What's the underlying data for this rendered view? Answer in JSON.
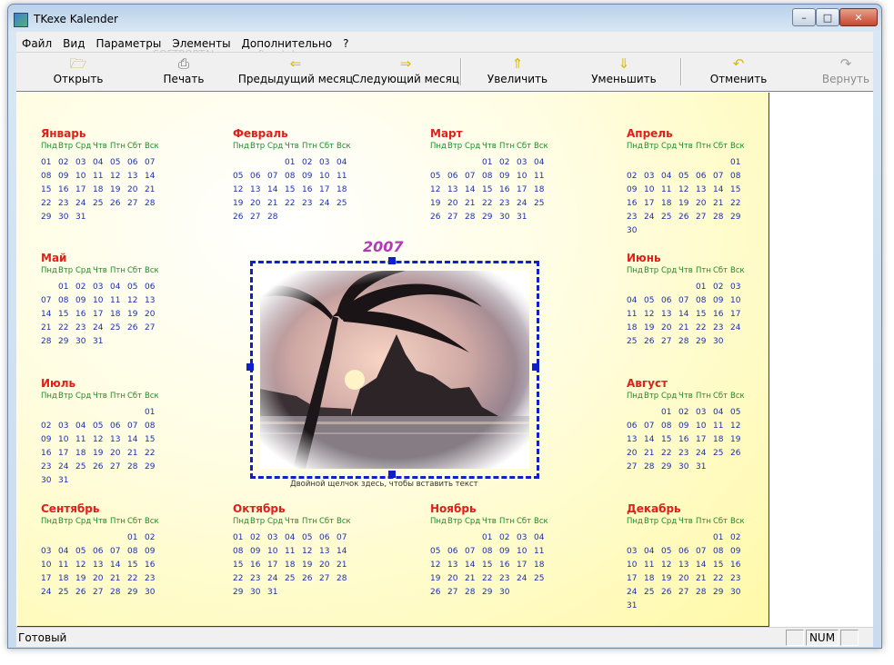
{
  "window": {
    "title": "TKexe Kalender"
  },
  "menu": [
    "Файл",
    "Вид",
    "Параметры",
    "Элементы",
    "Дополнительно",
    "?"
  ],
  "toolbar": {
    "open": "Открыть",
    "print": "Печать",
    "prev_month": "Предыдущий месяц",
    "next_month": "Следующий месяц",
    "zoom_in": "Увеличить",
    "zoom_out": "Уменьшить",
    "undo": "Отменить",
    "redo": "Вернуть"
  },
  "watermark": "SOFTPORTAL www.softportal.com",
  "calendar": {
    "year": "2007",
    "weekdays": [
      "Пнд",
      "Втр",
      "Срд",
      "Чтв",
      "Птн",
      "Сбт",
      "Вск"
    ],
    "photo_hint": "Двойной щелчок здесь, чтобы вставить текст",
    "months": [
      {
        "name": "Январь",
        "rows": [
          [
            "01",
            "02",
            "03",
            "04",
            "05",
            "06",
            "07"
          ],
          [
            "08",
            "09",
            "10",
            "11",
            "12",
            "13",
            "14"
          ],
          [
            "15",
            "16",
            "17",
            "18",
            "19",
            "20",
            "21"
          ],
          [
            "22",
            "23",
            "24",
            "25",
            "26",
            "27",
            "28"
          ],
          [
            "29",
            "30",
            "31",
            "",
            "",
            "",
            ""
          ]
        ]
      },
      {
        "name": "Февраль",
        "rows": [
          [
            "",
            "",
            "",
            "01",
            "02",
            "03",
            "04"
          ],
          [
            "05",
            "06",
            "07",
            "08",
            "09",
            "10",
            "11"
          ],
          [
            "12",
            "13",
            "14",
            "15",
            "16",
            "17",
            "18"
          ],
          [
            "19",
            "20",
            "21",
            "22",
            "23",
            "24",
            "25"
          ],
          [
            "26",
            "27",
            "28",
            "",
            "",
            "",
            ""
          ]
        ]
      },
      {
        "name": "Март",
        "rows": [
          [
            "",
            "",
            "",
            "01",
            "02",
            "03",
            "04"
          ],
          [
            "05",
            "06",
            "07",
            "08",
            "09",
            "10",
            "11"
          ],
          [
            "12",
            "13",
            "14",
            "15",
            "16",
            "17",
            "18"
          ],
          [
            "19",
            "20",
            "21",
            "22",
            "23",
            "24",
            "25"
          ],
          [
            "26",
            "27",
            "28",
            "29",
            "30",
            "31",
            ""
          ]
        ]
      },
      {
        "name": "Апрель",
        "rows": [
          [
            "",
            "",
            "",
            "",
            "",
            "",
            "01"
          ],
          [
            "02",
            "03",
            "04",
            "05",
            "06",
            "07",
            "08"
          ],
          [
            "09",
            "10",
            "11",
            "12",
            "13",
            "14",
            "15"
          ],
          [
            "16",
            "17",
            "18",
            "19",
            "20",
            "21",
            "22"
          ],
          [
            "23",
            "24",
            "25",
            "26",
            "27",
            "28",
            "29"
          ],
          [
            "30",
            "",
            "",
            "",
            "",
            "",
            ""
          ]
        ]
      },
      {
        "name": "Май",
        "rows": [
          [
            "",
            "01",
            "02",
            "03",
            "04",
            "05",
            "06"
          ],
          [
            "07",
            "08",
            "09",
            "10",
            "11",
            "12",
            "13"
          ],
          [
            "14",
            "15",
            "16",
            "17",
            "18",
            "19",
            "20"
          ],
          [
            "21",
            "22",
            "23",
            "24",
            "25",
            "26",
            "27"
          ],
          [
            "28",
            "29",
            "30",
            "31",
            "",
            "",
            ""
          ]
        ]
      },
      {
        "name": "Июнь",
        "rows": [
          [
            "",
            "",
            "",
            "",
            "01",
            "02",
            "03"
          ],
          [
            "04",
            "05",
            "06",
            "07",
            "08",
            "09",
            "10"
          ],
          [
            "11",
            "12",
            "13",
            "14",
            "15",
            "16",
            "17"
          ],
          [
            "18",
            "19",
            "20",
            "21",
            "22",
            "23",
            "24"
          ],
          [
            "25",
            "26",
            "27",
            "28",
            "29",
            "30",
            ""
          ]
        ]
      },
      {
        "name": "Июль",
        "rows": [
          [
            "",
            "",
            "",
            "",
            "",
            "",
            "01"
          ],
          [
            "02",
            "03",
            "04",
            "05",
            "06",
            "07",
            "08"
          ],
          [
            "09",
            "10",
            "11",
            "12",
            "13",
            "14",
            "15"
          ],
          [
            "16",
            "17",
            "18",
            "19",
            "20",
            "21",
            "22"
          ],
          [
            "23",
            "24",
            "25",
            "26",
            "27",
            "28",
            "29"
          ],
          [
            "30",
            "31",
            "",
            "",
            "",
            "",
            ""
          ]
        ]
      },
      {
        "name": "Август",
        "rows": [
          [
            "",
            "",
            "01",
            "02",
            "03",
            "04",
            "05"
          ],
          [
            "06",
            "07",
            "08",
            "09",
            "10",
            "11",
            "12"
          ],
          [
            "13",
            "14",
            "15",
            "16",
            "17",
            "18",
            "19"
          ],
          [
            "20",
            "21",
            "22",
            "23",
            "24",
            "25",
            "26"
          ],
          [
            "27",
            "28",
            "29",
            "30",
            "31",
            "",
            ""
          ]
        ]
      },
      {
        "name": "Сентябрь",
        "rows": [
          [
            "",
            "",
            "",
            "",
            "",
            "01",
            "02"
          ],
          [
            "03",
            "04",
            "05",
            "06",
            "07",
            "08",
            "09"
          ],
          [
            "10",
            "11",
            "12",
            "13",
            "14",
            "15",
            "16"
          ],
          [
            "17",
            "18",
            "19",
            "20",
            "21",
            "22",
            "23"
          ],
          [
            "24",
            "25",
            "26",
            "27",
            "28",
            "29",
            "30"
          ]
        ]
      },
      {
        "name": "Октябрь",
        "rows": [
          [
            "01",
            "02",
            "03",
            "04",
            "05",
            "06",
            "07"
          ],
          [
            "08",
            "09",
            "10",
            "11",
            "12",
            "13",
            "14"
          ],
          [
            "15",
            "16",
            "17",
            "18",
            "19",
            "20",
            "21"
          ],
          [
            "22",
            "23",
            "24",
            "25",
            "26",
            "27",
            "28"
          ],
          [
            "29",
            "30",
            "31",
            "",
            "",
            "",
            ""
          ]
        ]
      },
      {
        "name": "Ноябрь",
        "rows": [
          [
            "",
            "",
            "",
            "01",
            "02",
            "03",
            "04"
          ],
          [
            "05",
            "06",
            "07",
            "08",
            "09",
            "10",
            "11"
          ],
          [
            "12",
            "13",
            "14",
            "15",
            "16",
            "17",
            "18"
          ],
          [
            "19",
            "20",
            "21",
            "22",
            "23",
            "24",
            "25"
          ],
          [
            "26",
            "27",
            "28",
            "29",
            "30",
            "",
            ""
          ]
        ]
      },
      {
        "name": "Декабрь",
        "rows": [
          [
            "",
            "",
            "",
            "",
            "",
            "01",
            "02"
          ],
          [
            "03",
            "04",
            "05",
            "06",
            "07",
            "08",
            "09"
          ],
          [
            "10",
            "11",
            "12",
            "13",
            "14",
            "15",
            "16"
          ],
          [
            "17",
            "18",
            "19",
            "20",
            "21",
            "22",
            "23"
          ],
          [
            "24",
            "25",
            "26",
            "27",
            "28",
            "29",
            "30"
          ],
          [
            "31",
            "",
            "",
            "",
            "",
            "",
            ""
          ]
        ]
      }
    ]
  },
  "status": {
    "text": "Готовый",
    "num": "NUM"
  }
}
